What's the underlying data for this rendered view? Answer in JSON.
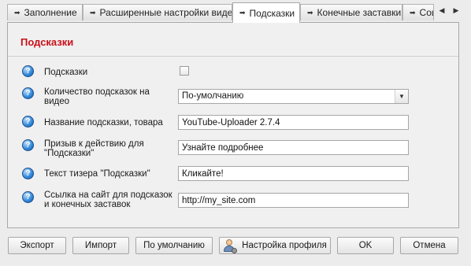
{
  "tabs": [
    {
      "label": "Заполнение",
      "active": false
    },
    {
      "label": "Расширенные настройки видео",
      "active": false
    },
    {
      "label": "Подсказки",
      "active": true
    },
    {
      "label": "Конечные заставки",
      "active": false
    },
    {
      "label": "Соц",
      "active": false
    }
  ],
  "tab_arrow_glyph": "➡",
  "tab_nav": {
    "prev": "◀",
    "next": "▶"
  },
  "section_title": "Подсказки",
  "help_glyph": "?",
  "rows": {
    "hints": {
      "label": "Подсказки",
      "checked": false
    },
    "hint_count": {
      "label": "Количество подсказок на видео",
      "value": "По-умолчанию",
      "dropdown_glyph": "▼"
    },
    "hint_name": {
      "label": "Название подсказки, товара",
      "value": "YouTube-Uploader 2.7.4"
    },
    "call_to_action": {
      "label": "Призыв к действию для \"Подсказки\"",
      "value": "Узнайте подробнее"
    },
    "teaser_text": {
      "label": "Текст тизера \"Подсказки\"",
      "value": "Кликайте!"
    },
    "site_link": {
      "label": "Ссылка на сайт для подсказок и конечных заставок",
      "value": "http://my_site.com"
    }
  },
  "buttons": {
    "export": "Экспорт",
    "import": "Импорт",
    "defaults": "По умолчанию",
    "profile_settings": "Настройка профиля",
    "ok": "OK",
    "cancel": "Отмена"
  },
  "colors": {
    "section_title": "#c8101a",
    "help_icon": "#2f86d8"
  }
}
